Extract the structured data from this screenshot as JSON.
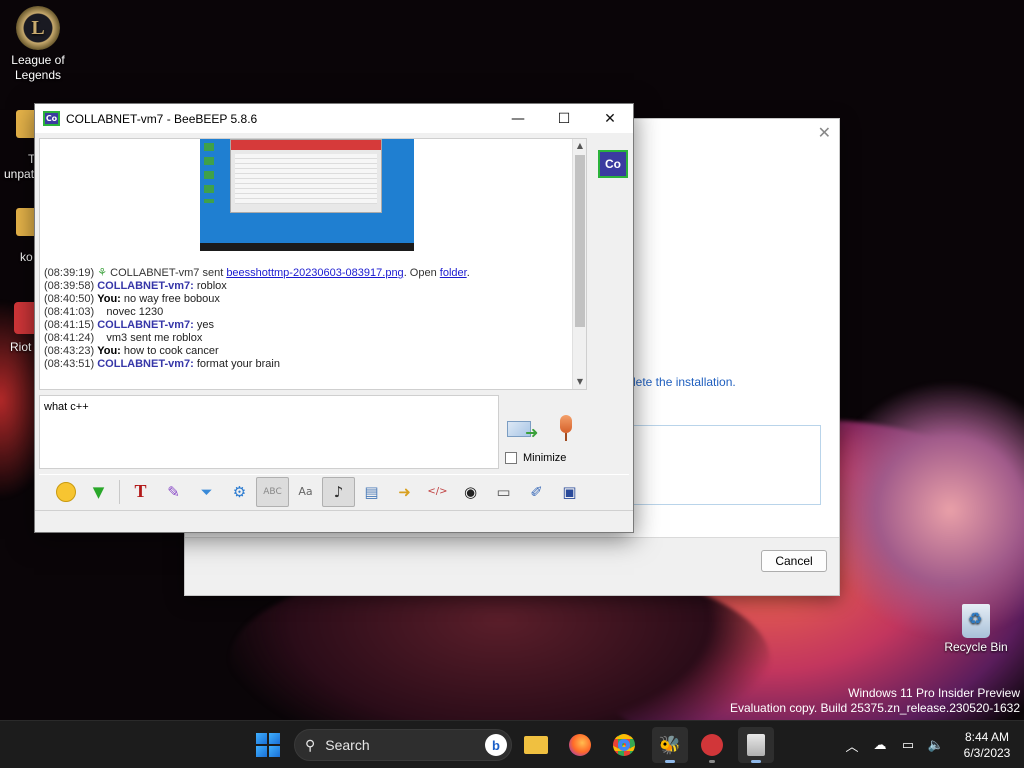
{
  "desktop": {
    "icons": [
      {
        "label": "League of Legends"
      },
      {
        "label": "T"
      },
      {
        "label": "unpat"
      },
      {
        "label": "ko"
      },
      {
        "label": "Riot"
      },
      {
        "label": "Recycle Bin"
      }
    ],
    "watermark": {
      "line1": "Windows 11 Pro Insider Preview",
      "line2": "Evaluation copy. Build 25375.zn_release.230520-1632"
    }
  },
  "installer": {
    "text": "lete the installation.",
    "cancel_label": "Cancel"
  },
  "beebeep": {
    "app_icon": "Co",
    "title": "COLLABNET-vm7 - BeeBEEP 5.8.6",
    "user_avatar": "Co",
    "messages": [
      {
        "time": "(08:39:19)",
        "pre": " COLLABNET-vm7 sent ",
        "link": "beesshottmp-20230603-083917.png",
        "mid": ". Open ",
        "link2": "folder",
        "post": "."
      },
      {
        "time": "(08:39:58)",
        "sender": "COLLABNET-vm7:",
        "text": " roblox"
      },
      {
        "time": "(08:40:50)",
        "sender": "You:",
        "text": " no way free boboux"
      },
      {
        "time": "(08:41:03)",
        "text": "    novec 1230"
      },
      {
        "time": "(08:41:15)",
        "sender": "COLLABNET-vm7:",
        "text": " yes"
      },
      {
        "time": "(08:41:24)",
        "text": "    vm3 sent me roblox"
      },
      {
        "time": "(08:43:23)",
        "sender": "You:",
        "text": " how to cook cancer"
      },
      {
        "time": "(08:43:51)",
        "sender": "COLLABNET-vm7:",
        "text": " format your brain"
      }
    ],
    "input_value": "what c++",
    "minimize_label": "Minimize",
    "toolbar": [
      "emoji-icon",
      "download-icon",
      "font-icon",
      "color-icon",
      "filter-icon",
      "settings-icon",
      "spellcheck-icon",
      "dictionary-icon",
      "sound-icon",
      "document-icon",
      "send-file-icon",
      "code-icon",
      "screenshot-icon",
      "terminal-icon",
      "edit-icon",
      "save-icon"
    ]
  },
  "taskbar": {
    "search_label": "Search",
    "time": "8:44 AM",
    "date": "6/3/2023"
  }
}
